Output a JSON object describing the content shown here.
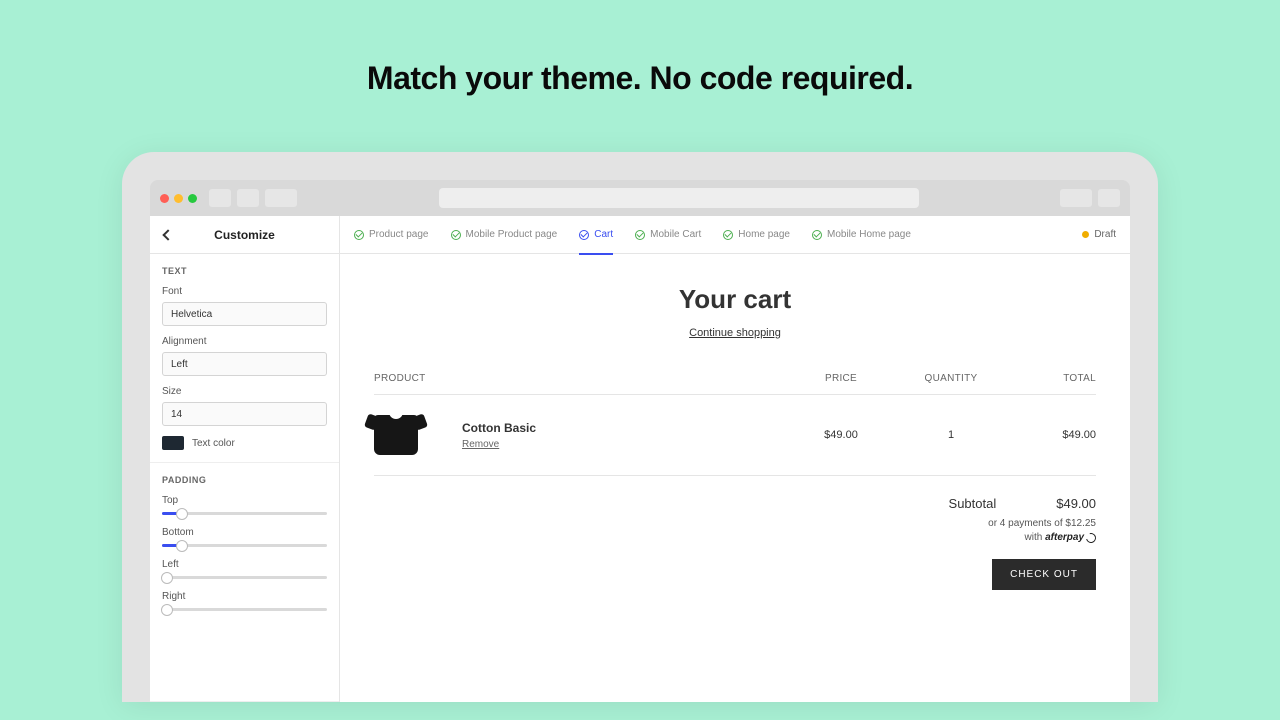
{
  "headline": "Match your theme. No code required.",
  "sidebar": {
    "title": "Customize",
    "sections": {
      "text": {
        "heading": "TEXT",
        "font_label": "Font",
        "font_value": "Helvetica",
        "alignment_label": "Alignment",
        "alignment_value": "Left",
        "size_label": "Size",
        "size_value": "14",
        "color_label": "Text color",
        "color_hex": "#1e2832"
      },
      "padding": {
        "heading": "PADDING",
        "top_label": "Top",
        "top_pct": 12,
        "bottom_label": "Bottom",
        "bottom_pct": 12,
        "left_label": "Left",
        "left_pct": 3,
        "right_label": "Right",
        "right_pct": 3
      }
    }
  },
  "tabs": {
    "items": [
      {
        "label": "Product page"
      },
      {
        "label": "Mobile Product page"
      },
      {
        "label": "Cart"
      },
      {
        "label": "Mobile Cart"
      },
      {
        "label": "Home page"
      },
      {
        "label": "Mobile Home page"
      }
    ],
    "active_index": 2,
    "status": "Draft"
  },
  "cart": {
    "title": "Your cart",
    "continue_label": "Continue shopping",
    "columns": {
      "product": "PRODUCT",
      "price": "PRICE",
      "quantity": "QUANTITY",
      "total": "TOTAL"
    },
    "items": [
      {
        "name": "Cotton Basic",
        "remove_label": "Remove",
        "price": "$49.00",
        "quantity": "1",
        "total": "$49.00"
      }
    ],
    "subtotal_label": "Subtotal",
    "subtotal_value": "$49.00",
    "installments_line1": "or 4 payments of $12.25",
    "installments_line2_prefix": "with",
    "afterpay_label": "afterpay",
    "checkout_label": "CHECK OUT"
  }
}
